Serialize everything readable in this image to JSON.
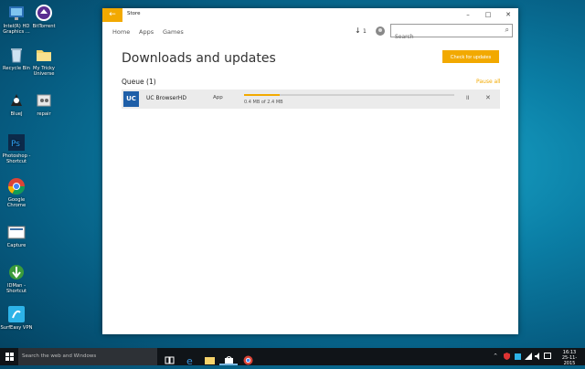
{
  "desktop": {
    "icons": [
      {
        "label": "Intel(R) HD Graphics ...",
        "icon": "intel-graphics-icon"
      },
      {
        "label": "BitTorrent",
        "icon": "bittorrent-icon"
      },
      {
        "label": "Recycle Bin",
        "icon": "recycle-bin-icon"
      },
      {
        "label": "My Tricky Universe",
        "icon": "folder-icon"
      },
      {
        "label": "BlueJ",
        "icon": "bluej-icon"
      },
      {
        "label": "repair",
        "icon": "repair-icon"
      },
      {
        "label": "Photoshop - Shortcut",
        "icon": "photoshop-icon"
      },
      {
        "label": "Google Chrome",
        "icon": "chrome-icon"
      },
      {
        "label": "Capture",
        "icon": "capture-icon"
      },
      {
        "label": "IDMan - Shortcut",
        "icon": "idman-icon"
      },
      {
        "label": "SurfEasy VPN",
        "icon": "surfeasy-icon"
      }
    ]
  },
  "window": {
    "title": "Store",
    "back_glyph": "←",
    "minimize_glyph": "–",
    "maximize_glyph": "□",
    "close_glyph": "✕"
  },
  "nav": {
    "items": [
      "Home",
      "Apps",
      "Games"
    ],
    "download_count": "1",
    "download_glyph": "↓",
    "search_placeholder": "Search",
    "search_glyph": "⌕"
  },
  "main": {
    "title": "Downloads and updates",
    "check_button": "Check for updates",
    "queue_title": "Queue (1)",
    "pause_all": "Pause all",
    "queue": [
      {
        "name": "UC BrowserHD",
        "type": "App",
        "progress_text": "0.4 MB of 2.4 MB",
        "progress_fraction": 0.17,
        "icon_text": "UC",
        "pause_glyph": "II",
        "cancel_glyph": "✕"
      }
    ]
  },
  "taskbar": {
    "search_placeholder": "Search the web and Windows",
    "time": "16:13",
    "date": "25-11-2015"
  },
  "colors": {
    "accent": "#f2a900",
    "uc_blue": "#1f5fa8"
  }
}
